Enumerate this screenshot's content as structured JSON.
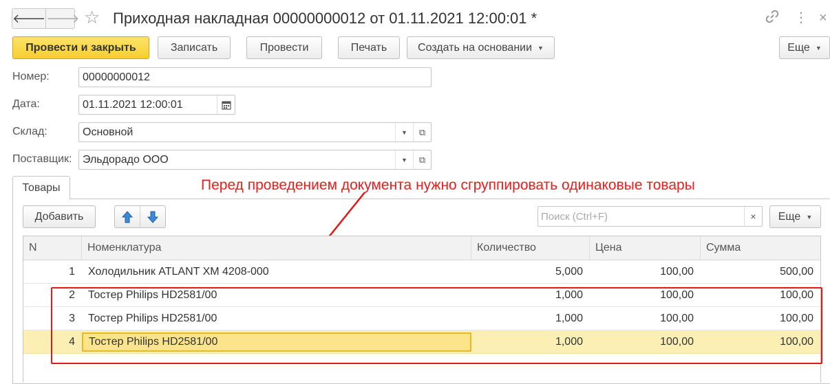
{
  "window": {
    "title": "Приходная накладная 00000000012 от 01.11.2021 12:00:01 *",
    "back_icon": "arrow-left-icon",
    "forward_icon": "arrow-right-icon",
    "favorite_icon": "star-icon",
    "link_icon": "link-icon",
    "menu_icon": "more-vertical-icon",
    "close_icon": "close-icon"
  },
  "toolbar": {
    "post_and_close": "Провести и закрыть",
    "save": "Записать",
    "post": "Провести",
    "print": "Печать",
    "create_based_on": "Создать на основании",
    "more": "Еще"
  },
  "form": {
    "number": {
      "label": "Номер:",
      "value": "00000000012"
    },
    "date": {
      "label": "Дата:",
      "value": "01.11.2021 12:00:01"
    },
    "warehouse": {
      "label": "Склад:",
      "value": "Основной"
    },
    "supplier": {
      "label": "Поставщик:",
      "value": "Эльдорадо ООО"
    }
  },
  "tabs": [
    {
      "label": "Товары",
      "active": true
    }
  ],
  "annotation": {
    "text": "Перед проведением документа нужно сгруппировать одинаковые товары",
    "color": "#ee1b1b"
  },
  "table_toolbar": {
    "add": "Добавить",
    "search_placeholder": "Поиск (Ctrl+F)",
    "clear": "×",
    "more": "Еще"
  },
  "table": {
    "columns": [
      "N",
      "Номенклатура",
      "Количество",
      "Цена",
      "Сумма"
    ],
    "rows": [
      {
        "n": "1",
        "name": "Холодильник ATLANT ХМ 4208-000",
        "qty": "5,000",
        "price": "100,00",
        "sum": "500,00",
        "selected": false
      },
      {
        "n": "2",
        "name": "Тостер Philips HD2581/00",
        "qty": "1,000",
        "price": "100,00",
        "sum": "100,00",
        "selected": false
      },
      {
        "n": "3",
        "name": "Тостер Philips HD2581/00",
        "qty": "1,000",
        "price": "100,00",
        "sum": "100,00",
        "selected": false
      },
      {
        "n": "4",
        "name": "Тостер Philips HD2581/00",
        "qty": "1,000",
        "price": "100,00",
        "sum": "100,00",
        "selected": true
      }
    ]
  },
  "colors": {
    "primary_button": "#f5cf2e",
    "selected_row": "#fcefb4",
    "annotation_red": "#e01818",
    "arrow_blue": "#3a8ad8"
  }
}
